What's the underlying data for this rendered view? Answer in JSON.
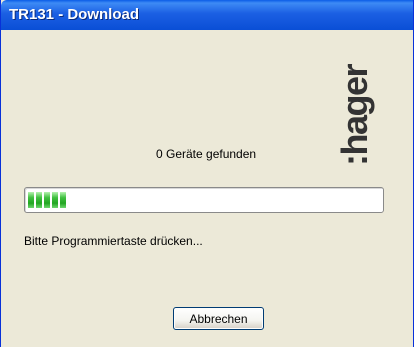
{
  "window": {
    "title": "TR131 - Download"
  },
  "logo": {
    "text": "hager",
    "icon": "hager-logo"
  },
  "status": {
    "devices_found": "0 Geräte gefunden"
  },
  "progress": {
    "chunks": 5
  },
  "instruction": {
    "text": "Bitte Programmiertaste drücken..."
  },
  "buttons": {
    "cancel_label": "Abbrechen"
  },
  "colors": {
    "titlebar": "#0a5ce6",
    "dialog_background": "#ece9d8",
    "progress_fill": "#22a622",
    "logo": "#333333"
  }
}
